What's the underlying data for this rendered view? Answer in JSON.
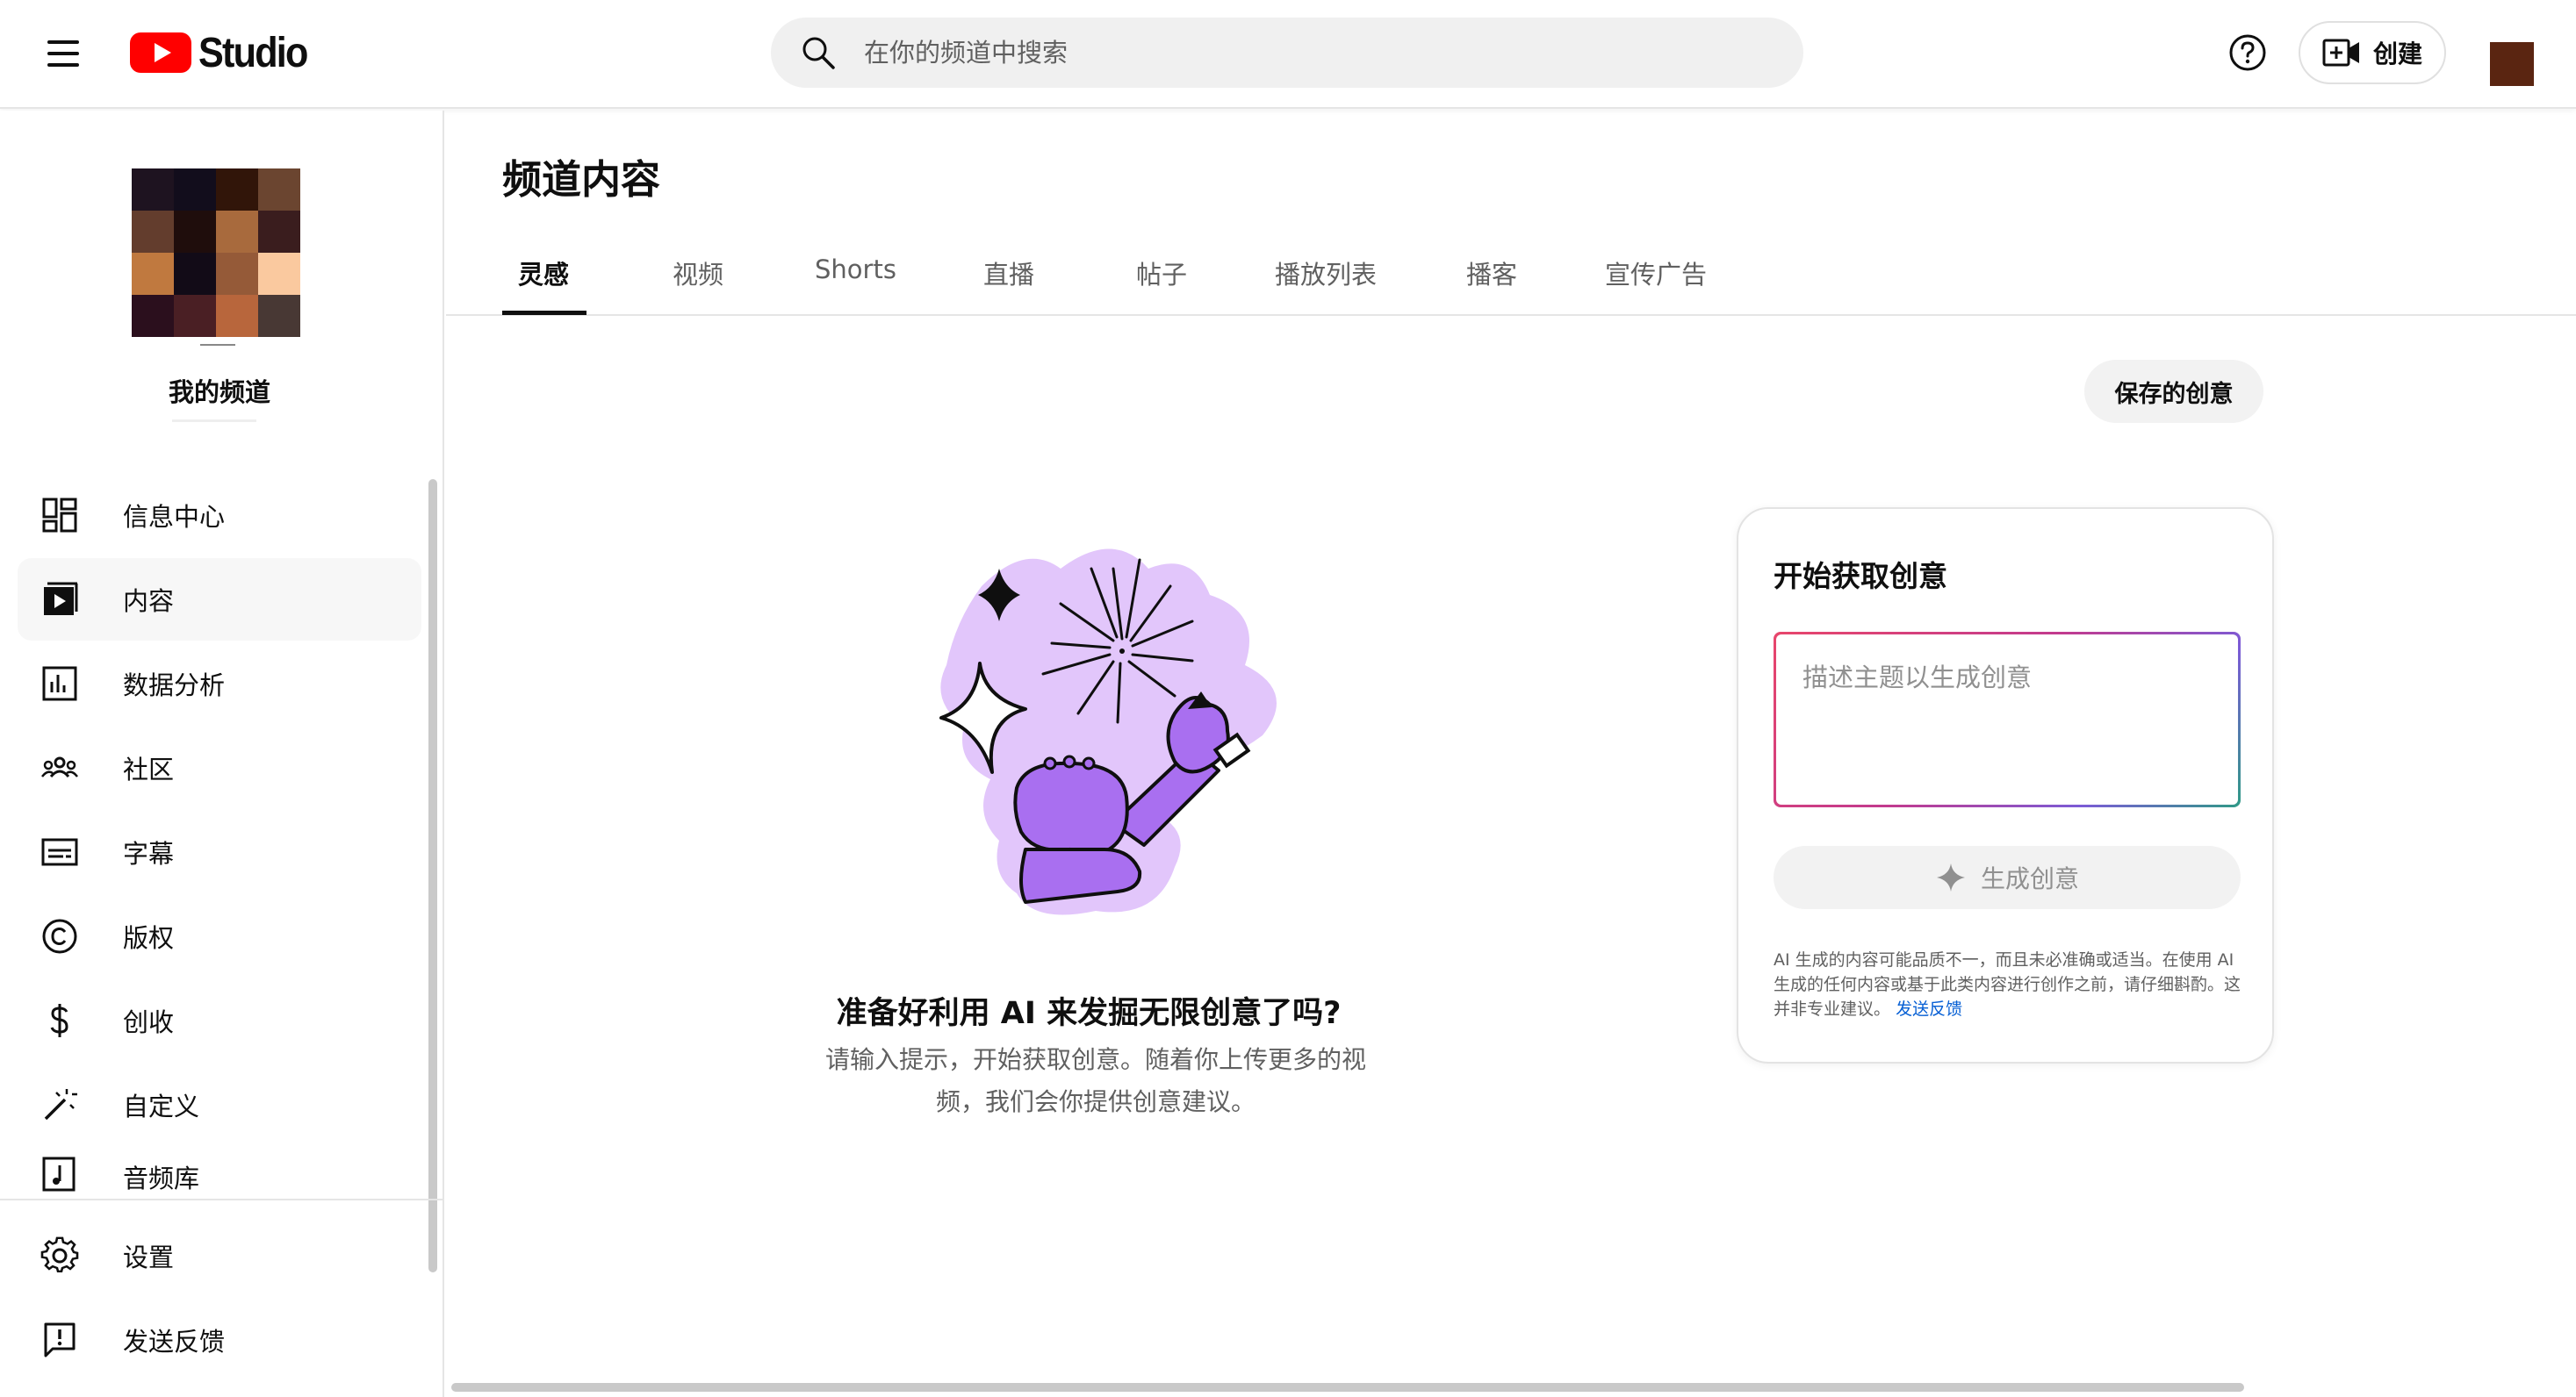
{
  "header": {
    "logo_text": "Studio",
    "search_placeholder": "在你的频道中搜索",
    "create_label": "创建"
  },
  "sidebar": {
    "channel_name": "我的频道",
    "items": [
      {
        "label": "信息中心",
        "icon": "dashboard-icon"
      },
      {
        "label": "内容",
        "icon": "content-icon",
        "active": true
      },
      {
        "label": "数据分析",
        "icon": "analytics-icon"
      },
      {
        "label": "社区",
        "icon": "community-icon"
      },
      {
        "label": "字幕",
        "icon": "subtitles-icon"
      },
      {
        "label": "版权",
        "icon": "copyright-icon"
      },
      {
        "label": "创收",
        "icon": "earn-icon"
      },
      {
        "label": "自定义",
        "icon": "customize-icon"
      },
      {
        "label": "音频库",
        "icon": "audio-library-icon"
      }
    ],
    "bottom_items": [
      {
        "label": "设置",
        "icon": "settings-icon"
      },
      {
        "label": "发送反馈",
        "icon": "feedback-icon"
      }
    ]
  },
  "main": {
    "page_title": "频道内容",
    "tabs": [
      {
        "label": "灵感",
        "active": true
      },
      {
        "label": "视频"
      },
      {
        "label": "Shorts"
      },
      {
        "label": "直播"
      },
      {
        "label": "帖子"
      },
      {
        "label": "播放列表"
      },
      {
        "label": "播客"
      },
      {
        "label": "宣传广告"
      }
    ],
    "saved_ideas_label": "保存的创意",
    "empty_state": {
      "title": "准备好利用 AI 来发掘无限创意了吗?",
      "description_line1": "请输入提示，开始获取创意。随着你上传更多的视",
      "description_line2": "频，我们会你提供创意建议。"
    },
    "idea_card": {
      "title": "开始获取创意",
      "input_placeholder": "描述主题以生成创意",
      "generate_label": "生成创意",
      "disclaimer": "AI 生成的内容可能品质不一，而且未必准确或适当。在使用 AI 生成的任何内容或基于此类内容进行创作之前，请仔细斟酌。这并非专业建议。",
      "feedback_link": "发送反馈"
    }
  },
  "colors": {
    "accent": "#0f0f0f",
    "youtube_red": "#ff0000",
    "illustration_purple": "#a96ff0",
    "illustration_lilac": "#e2c6fb",
    "link_blue": "#065fd4"
  }
}
